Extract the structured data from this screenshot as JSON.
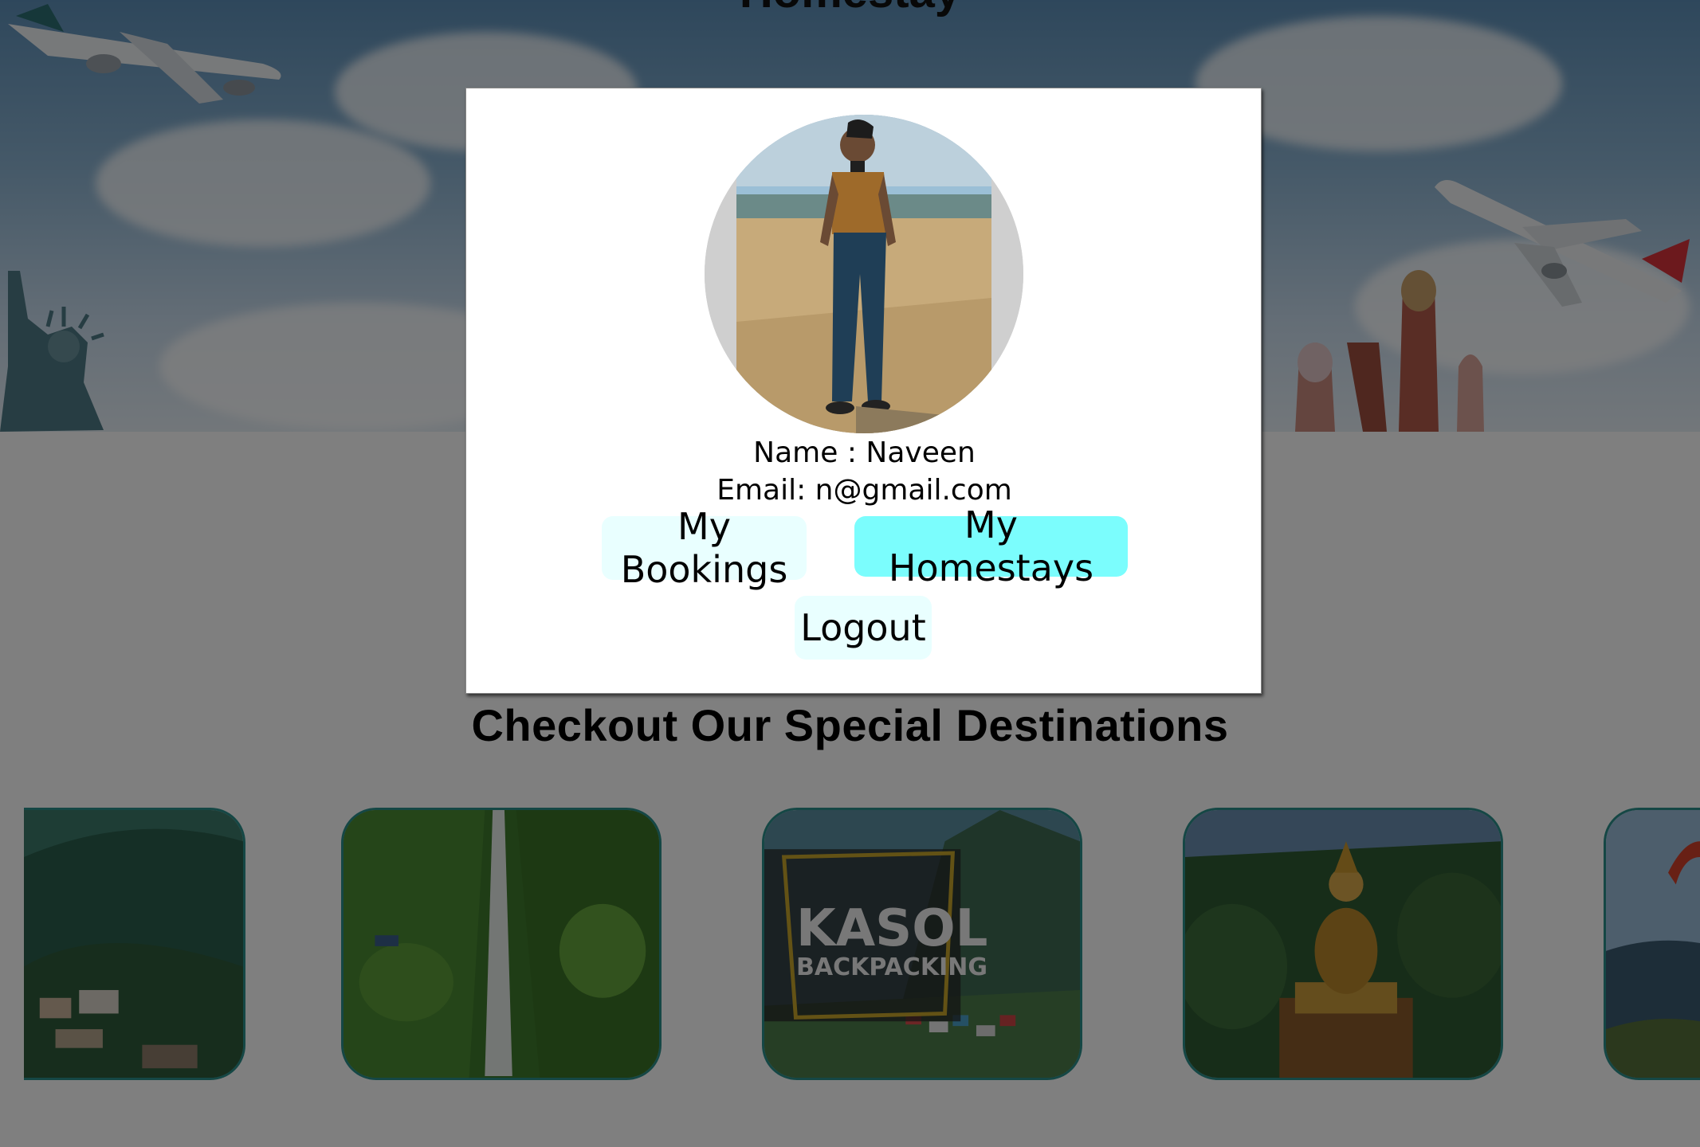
{
  "page": {
    "top_heading": "Homestay",
    "section_heading": "Checkout Our Special Destinations"
  },
  "destinations": [
    {
      "name": "hill-town-card",
      "overlay_title": "",
      "overlay_subtitle": ""
    },
    {
      "name": "waterfall-card",
      "overlay_title": "",
      "overlay_subtitle": ""
    },
    {
      "name": "kasol-card",
      "overlay_title": "KASOL",
      "overlay_subtitle": "BACKPACKING"
    },
    {
      "name": "monastery-statue-card",
      "overlay_title": "",
      "overlay_subtitle": ""
    },
    {
      "name": "paragliding-card",
      "overlay_title": "",
      "overlay_subtitle": ""
    }
  ],
  "profile": {
    "name_line": "Name : Naveen",
    "email_line": "Email: n@gmail.com",
    "buttons": {
      "bookings": "My Bookings",
      "homestays": "My Homestays",
      "logout": "Logout"
    }
  },
  "colors": {
    "accent_button": "#7bfdfd",
    "light_button": "#e9ffff",
    "card_border": "#2a8f8a",
    "overlay": "rgba(0,0,0,0.5)"
  }
}
